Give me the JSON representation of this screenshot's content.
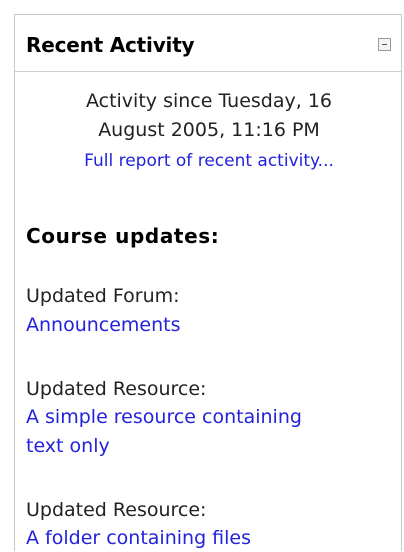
{
  "block": {
    "title": "Recent Activity",
    "toggle_icon": "collapse-minus-icon"
  },
  "activity": {
    "since_line1": "Activity since Tuesday, 16",
    "since_line2": "August 2005, 11:16 PM",
    "full_report_link": "Full report of recent activity..."
  },
  "updates": {
    "heading": "Course updates:",
    "entries": [
      {
        "label": "Updated Forum:",
        "link": "Announcements"
      },
      {
        "label": "Updated Resource:",
        "link_line1": "A simple resource containing",
        "link_line2": "text only"
      },
      {
        "label": "Updated Resource:",
        "link": "A folder containing files"
      }
    ]
  },
  "colors": {
    "link": "#2222dd",
    "text": "#222222",
    "border": "#c9c9c9"
  }
}
